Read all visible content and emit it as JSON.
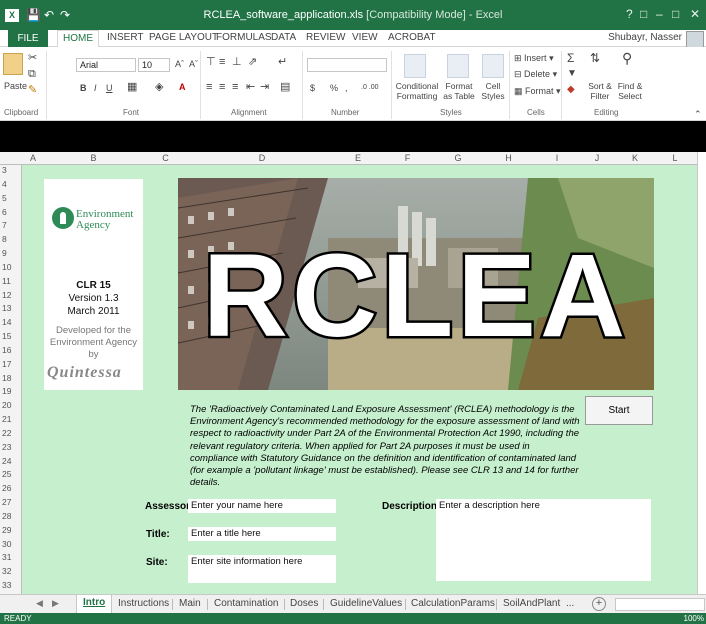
{
  "window": {
    "title": "RCLEA_software_application.xls",
    "mode": "[Compatibility Mode] - Excel",
    "help": "?",
    "controls": [
      "□",
      "–",
      "□",
      "✕"
    ]
  },
  "ribbon_tabs": [
    "FILE",
    "HOME",
    "INSERT",
    "PAGE LAYOUT",
    "FORMULAS",
    "DATA",
    "REVIEW",
    "VIEW",
    "ACROBAT"
  ],
  "user": "Shubayr, Nasser",
  "ribbon": {
    "paste": "Paste",
    "font_name": "Arial",
    "font_size": "10",
    "bold": "B",
    "italic": "I",
    "underline": "U",
    "number_format_prefix": "$",
    "percent": "%",
    "comma": ",",
    "decimals": ".0 .00",
    "conditional_formatting": "Conditional Formatting",
    "format_as_table": "Format as Table",
    "cell_styles": "Cell Styles",
    "insert": "Insert",
    "delete": "Delete",
    "format": "Format",
    "sort_filter": "Sort & Filter",
    "find_select": "Find & Select",
    "groups": [
      "Clipboard",
      "Font",
      "Alignment",
      "Number",
      "Styles",
      "Cells",
      "Editing"
    ]
  },
  "columns": [
    "A",
    "B",
    "C",
    "D",
    "E",
    "F",
    "G",
    "H",
    "I",
    "J",
    "K",
    "L"
  ],
  "rows": [
    "3",
    "4",
    "5",
    "6",
    "7",
    "8",
    "9",
    "10",
    "11",
    "12",
    "13",
    "14",
    "15",
    "16",
    "17",
    "18",
    "19",
    "20",
    "21",
    "22",
    "23",
    "24",
    "25",
    "26",
    "27",
    "28",
    "29",
    "30",
    "31",
    "32",
    "33"
  ],
  "logo_panel": {
    "org_line1": "Environment",
    "org_line2": "Agency",
    "clr": "CLR 15",
    "version": "Version 1.3",
    "date": "March 2011",
    "developed_1": "Developed for the",
    "developed_2": "Environment Agency",
    "developed_3": "by",
    "developer": "Quintessa"
  },
  "banner_title": "RCLEA",
  "description_paragraph": "The 'Radioactively Contaminated Land Exposure Assessment' (RCLEA) methodology is the Environment Agency's recommended methodology for the exposure assessment of land with respect to radioactivity under Part 2A of the Environmental Protection Act 1990, including the relevant regulatory criteria.  When applied for Part 2A purposes it must be used in compliance with Statutory Guidance on the definition and identification of contaminated land (for example a 'pollutant linkage' must be established).  Please see CLR 13 and 14 for further details.",
  "start_label": "Start",
  "form": {
    "assessor_label": "Assessor:",
    "assessor_value": "Enter your name here",
    "title_label": "Title:",
    "title_value": "Enter a title here",
    "site_label": "Site:",
    "site_value": "Enter site information here",
    "description_label": "Description:",
    "description_value": "Enter a description here"
  },
  "sheet_tabs": [
    "Intro",
    "Instructions",
    "Main",
    "Contamination",
    "Doses",
    "GuidelineValues",
    "CalculationParams",
    "SoilAndPlant",
    "..."
  ],
  "status": {
    "ready": "READY",
    "zoom": "100%"
  },
  "colors": {
    "excel_green": "#217346",
    "sheet_background": "#c6efce"
  }
}
